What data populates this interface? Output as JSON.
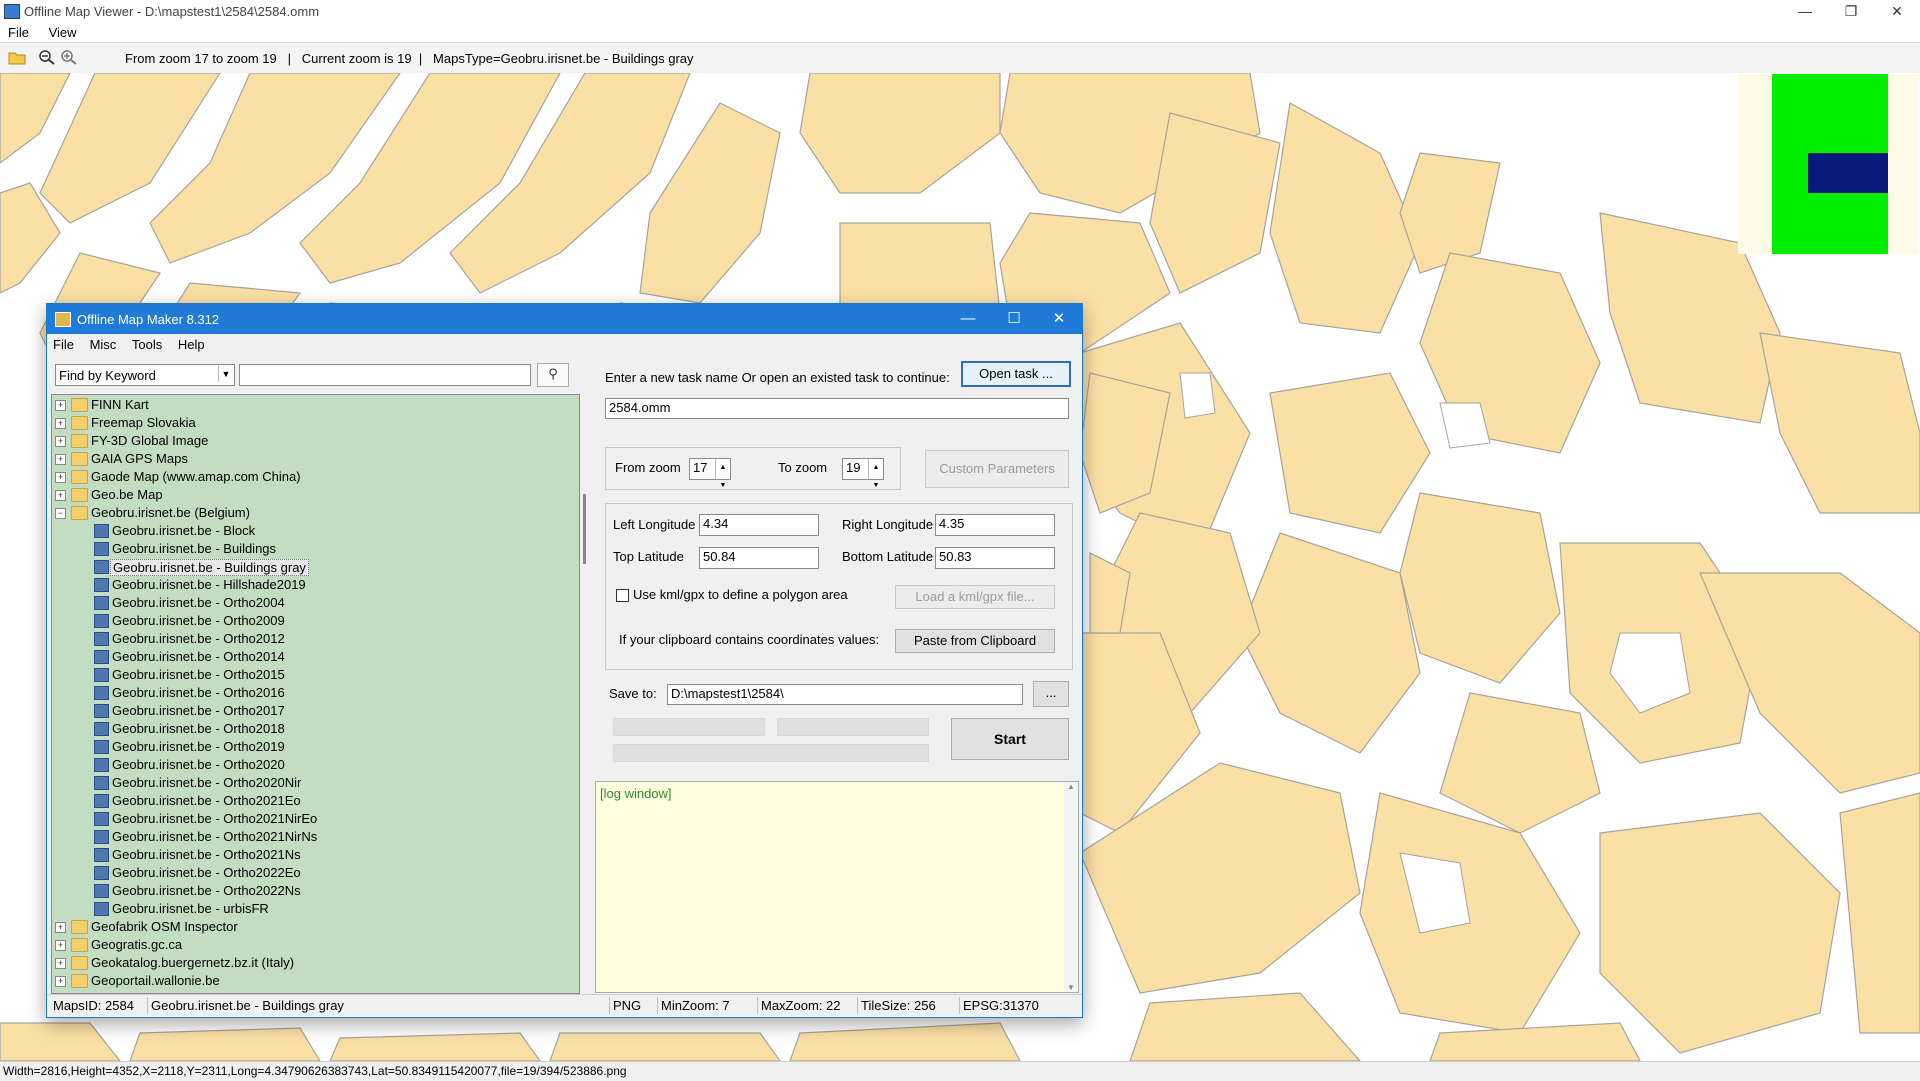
{
  "viewer": {
    "title": "Offline Map Viewer - D:\\mapstest1\\2584\\2584.omm",
    "menu": [
      "File",
      "View"
    ],
    "toolbar_info": "From zoom 17 to zoom 19   |   Current zoom is 19  |   MapsType=Geobru.irisnet.be - Buildings gray",
    "status": "Width=2816,Height=4352,X=2118,Y=2311,Long=4.34790626383743,Lat=50.8349115420077,file=19/394/523886.png",
    "colors": {
      "building_fill": "#fbe0a6",
      "building_stroke": "#a8a39a",
      "minimap_green": "#00ee00",
      "minimap_navy": "#0b1a7a"
    }
  },
  "dialog": {
    "title": "Offline Map Maker 8.312",
    "menu": [
      "File",
      "Misc",
      "Tools",
      "Help"
    ],
    "search": {
      "mode": "Find by Keyword",
      "keyword": ""
    },
    "tree": [
      {
        "label": "FINN Kart",
        "level": 0,
        "expanded": false
      },
      {
        "label": "Freemap Slovakia",
        "level": 0,
        "expanded": false
      },
      {
        "label": "FY-3D Global Image",
        "level": 0,
        "expanded": false
      },
      {
        "label": "GAIA GPS Maps",
        "level": 0,
        "expanded": false
      },
      {
        "label": "Gaode Map (www.amap.com China)",
        "level": 0,
        "expanded": false
      },
      {
        "label": "Geo.be Map",
        "level": 0,
        "expanded": false
      },
      {
        "label": "Geobru.irisnet.be (Belgium)",
        "level": 0,
        "expanded": true
      },
      {
        "label": "Geobru.irisnet.be - Block",
        "level": 1
      },
      {
        "label": "Geobru.irisnet.be - Buildings",
        "level": 1
      },
      {
        "label": "Geobru.irisnet.be - Buildings gray",
        "level": 1,
        "selected": true
      },
      {
        "label": "Geobru.irisnet.be - Hillshade2019",
        "level": 1
      },
      {
        "label": "Geobru.irisnet.be - Ortho2004",
        "level": 1
      },
      {
        "label": "Geobru.irisnet.be - Ortho2009",
        "level": 1
      },
      {
        "label": "Geobru.irisnet.be - Ortho2012",
        "level": 1
      },
      {
        "label": "Geobru.irisnet.be - Ortho2014",
        "level": 1
      },
      {
        "label": "Geobru.irisnet.be - Ortho2015",
        "level": 1
      },
      {
        "label": "Geobru.irisnet.be - Ortho2016",
        "level": 1
      },
      {
        "label": "Geobru.irisnet.be - Ortho2017",
        "level": 1
      },
      {
        "label": "Geobru.irisnet.be - Ortho2018",
        "level": 1
      },
      {
        "label": "Geobru.irisnet.be - Ortho2019",
        "level": 1
      },
      {
        "label": "Geobru.irisnet.be - Ortho2020",
        "level": 1
      },
      {
        "label": "Geobru.irisnet.be - Ortho2020Nir",
        "level": 1
      },
      {
        "label": "Geobru.irisnet.be - Ortho2021Eo",
        "level": 1
      },
      {
        "label": "Geobru.irisnet.be - Ortho2021NirEo",
        "level": 1
      },
      {
        "label": "Geobru.irisnet.be - Ortho2021NirNs",
        "level": 1
      },
      {
        "label": "Geobru.irisnet.be - Ortho2021Ns",
        "level": 1
      },
      {
        "label": "Geobru.irisnet.be - Ortho2022Eo",
        "level": 1
      },
      {
        "label": "Geobru.irisnet.be - Ortho2022Ns",
        "level": 1
      },
      {
        "label": "Geobru.irisnet.be - urbisFR",
        "level": 1
      },
      {
        "label": "Geofabrik OSM Inspector",
        "level": 0,
        "expanded": false
      },
      {
        "label": "Geogratis.gc.ca",
        "level": 0,
        "expanded": false
      },
      {
        "label": "Geokatalog.buergernetz.bz.it (Italy)",
        "level": 0,
        "expanded": false
      },
      {
        "label": "Geoportail.wallonie.be",
        "level": 0,
        "expanded": false
      }
    ],
    "task_prompt": "Enter a new task name Or open an existed task to continue:",
    "open_task_label": "Open task ...",
    "task_name": "2584.omm",
    "from_zoom_label": "From zoom",
    "from_zoom": "17",
    "to_zoom_label": "To zoom",
    "to_zoom": "19",
    "custom_params_label": "Custom Parameters",
    "left_lon_label": "Left Longitude",
    "left_lon": "4.34",
    "right_lon_label": "Right Longitude",
    "right_lon": "4.35",
    "top_lat_label": "Top Latitude",
    "top_lat": "50.84",
    "bottom_lat_label": "Bottom Latitude",
    "bottom_lat": "50.83",
    "kml_label": "Use kml/gpx to define a polygon area",
    "kml_checked": false,
    "load_kml_label": "Load a kml/gpx file...",
    "clipboard_label": "If your clipboard contains coordinates values:",
    "paste_label": "Paste from Clipboard",
    "save_to_label": "Save to:",
    "save_to": "D:\\mapstest1\\2584\\",
    "browse_label": "...",
    "start_label": "Start",
    "progress": [
      0,
      0,
      0
    ],
    "log_text": "[log window]",
    "status": {
      "maps_id": "MapsID: 2584",
      "map_name": "Geobru.irisnet.be - Buildings gray",
      "format": "PNG",
      "min_zoom": "MinZoom: 7",
      "max_zoom": "MaxZoom: 22",
      "tile_size": "TileSize: 256",
      "epsg": "EPSG:31370"
    }
  }
}
